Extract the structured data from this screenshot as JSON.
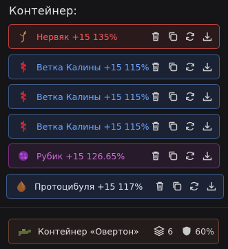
{
  "container_title": "Контейнер:",
  "items": [
    {
      "label": "Нервяк +15 135%",
      "icon": "root-icon",
      "variant": "red"
    },
    {
      "label": "Ветка Калины +15 115%",
      "icon": "berry-branch-icon",
      "variant": "blue"
    },
    {
      "label": "Ветка Калины +15 115%",
      "icon": "berry-branch-icon",
      "variant": "blue"
    },
    {
      "label": "Ветка Калины +15 115%",
      "icon": "berry-branch-icon",
      "variant": "blue"
    },
    {
      "label": "Рубик +15 126.65%",
      "icon": "ruby-cube-icon",
      "variant": "purple"
    },
    {
      "label": "Протоцибуля +15 117%",
      "icon": "onion-bulb-icon",
      "variant": "neutral"
    }
  ],
  "actions": [
    "trash-icon",
    "copy-icon",
    "refresh-icon",
    "download-icon"
  ],
  "footer": {
    "label": "Контейнер «Овертон»",
    "icon": "container-gun-icon",
    "layers_value": "6",
    "shield_value": "60%"
  },
  "colors": {
    "red_label": "#ff5a5a",
    "blue_label": "#6fa4ff",
    "purple_label": "#d26cd7",
    "neutral_label": "#e0e6f0"
  }
}
